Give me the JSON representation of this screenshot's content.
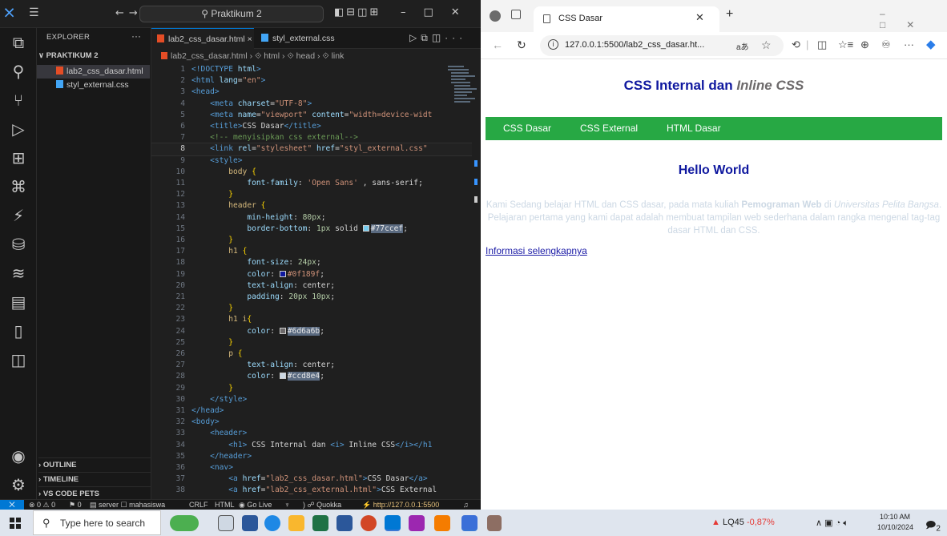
{
  "vscode": {
    "title_search": "Praktikum 2",
    "menu_icon": "hamburger-icon",
    "sidebar": {
      "header": "EXPLORER",
      "folder": "PRAKTIKUM 2",
      "files": [
        {
          "name": "lab2_css_dasar.html",
          "type": "html",
          "active": true
        },
        {
          "name": "styl_external.css",
          "type": "css",
          "active": false
        }
      ],
      "sections": [
        "OUTLINE",
        "TIMELINE",
        "VS CODE PETS"
      ]
    },
    "tabs": [
      {
        "label": "lab2_css_dasar.html",
        "close": "×",
        "type": "html",
        "active": true
      },
      {
        "label": "styl_external.css",
        "type": "css",
        "active": false
      }
    ],
    "breadcrumb": [
      "lab2_css_dasar.html",
      "html",
      "head",
      "link"
    ],
    "current_line": 8,
    "status": {
      "problems": "⊗ 0 ⚠ 0",
      "ports": "0",
      "server": "server",
      "user": "mahasiswa",
      "eol": "CRLF",
      "language": "HTML",
      "go_live": "Go Live",
      "quokka": "Quokka",
      "live_url": "http://127.0.0.1:5500"
    },
    "colors": {
      "accent": "#0078d4",
      "swatch1": "#77ccef",
      "swatch2": "#0f189f",
      "swatch3": "#6d6a6b",
      "swatch4": "#ccd8e4"
    }
  },
  "browser": {
    "tab_title": "CSS Dasar",
    "url": "127.0.0.1:5500/lab2_css_dasar.ht...",
    "read_aloud": "aあ",
    "page": {
      "h1_text": "CSS Internal dan ",
      "h1_italic": "Inline CSS",
      "nav": [
        "CSS Dasar",
        "CSS External",
        "HTML Dasar"
      ],
      "h2": "Hello World",
      "p_1": "Kami Sedang belajar HTML dan CSS dasar, pada mata kuliah ",
      "p_bold": "Pemograman Web",
      "p_2": " di ",
      "p_italic": "Universitas Pelita Bangsa",
      "p_3": ". Pelajaran pertama yang kami dapat adalah membuat tampilan web sederhana dalam rangka mengenal tag-tag dasar HTML dan CSS.",
      "link": "Informasi selengkapnya"
    },
    "colors": {
      "heading": "#0f189f",
      "italic": "#6d6a6b",
      "nav_bg": "#27a844",
      "para": "#ccd8e4"
    }
  },
  "taskbar": {
    "search_placeholder": "Type here to search",
    "stock_name": "LQ45",
    "stock_change": "-0,87%",
    "time": "10:10 AM",
    "date": "10/10/2024",
    "notif_count": "2"
  }
}
